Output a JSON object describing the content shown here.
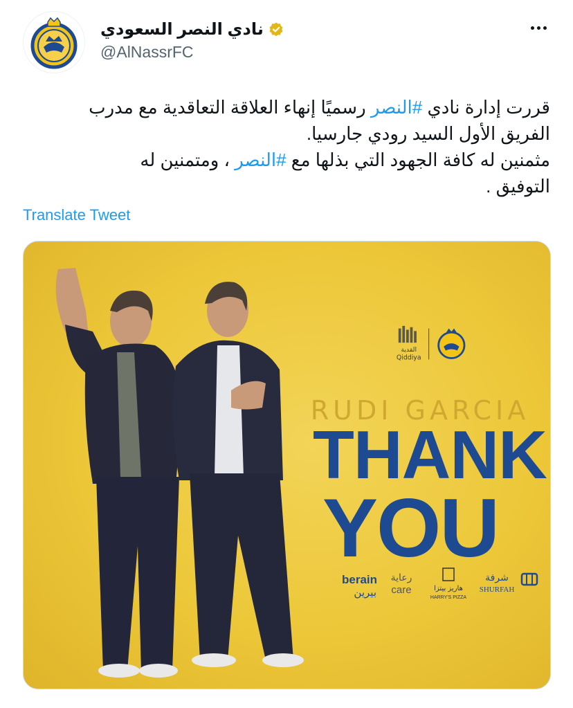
{
  "account": {
    "display_name": "نادي النصر السعودي",
    "handle": "@AlNassrFC",
    "avatar_icon": "al-nassr-crest-icon",
    "verified_icon": "verified-gold-badge-icon",
    "verified_color": "#e2b719"
  },
  "more_icon": "more-horizontal-icon",
  "tweet": {
    "line1_before": "قررت إدارة نادي ",
    "line1_hashtag": "#النصر",
    "line1_after": " رسميًا إنهاء العلاقة التعاقدية مع مدرب",
    "line2": "الفريق الأول السيد رودي جارسيا.",
    "line3_before": "مثمنين له كافة الجهود التي بذلها مع ",
    "line3_hashtag": "#النصر",
    "line3_after": " ، ومتمنين له",
    "line4": "التوفيق ."
  },
  "translate_label": "Translate Tweet",
  "media": {
    "subtitle": "RUDI GARCIA",
    "title_line1": "THANK",
    "title_line2": "YOU",
    "top_logos": [
      "qiddiya-logo",
      "al-nassr-crest-icon"
    ],
    "qiddiya_ar": "القدية",
    "qiddiya_en": "Qiddiya",
    "sponsors": [
      {
        "name": "berain-logo",
        "text_en": "berain",
        "text_ar": "بيرين"
      },
      {
        "name": "care-logo",
        "text_en": "care",
        "text_ar": "رعاية"
      },
      {
        "name": "harrys-pizza-logo",
        "text_en": "HARRY'S PIZZA",
        "text_ar": "هاريز بيتزا"
      },
      {
        "name": "shurfah-logo",
        "text_en": "SHURFAH",
        "text_ar": "شرفة"
      }
    ],
    "background_color": "#ecc738",
    "title_color": "#1e4a92"
  }
}
